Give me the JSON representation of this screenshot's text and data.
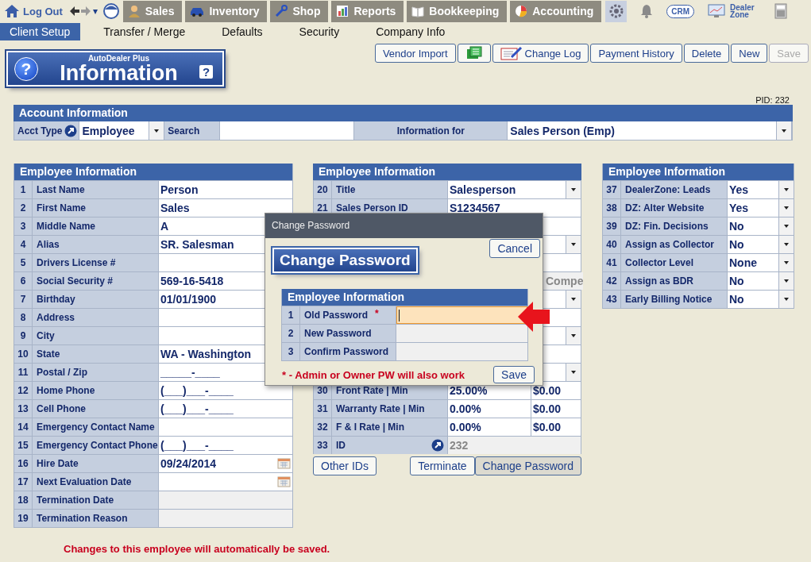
{
  "top_nav": {
    "logout": "Log Out",
    "history_caret": "▾",
    "modules": [
      {
        "label": "Sales",
        "kind": "sales"
      },
      {
        "label": "Inventory",
        "kind": "inventory"
      },
      {
        "label": "Shop",
        "kind": "shop"
      },
      {
        "label": "Reports",
        "kind": "reports"
      },
      {
        "label": "Bookkeeping",
        "kind": "bookkeeping"
      },
      {
        "label": "Accounting",
        "kind": "accounting"
      }
    ],
    "crm": "CRM",
    "dealer_zone": "Dealer Zone"
  },
  "subtabs": [
    {
      "label": "Client Setup",
      "selected": true
    },
    {
      "label": "Transfer / Merge",
      "selected": false
    },
    {
      "label": "Defaults",
      "selected": false
    },
    {
      "label": "Security",
      "selected": false
    },
    {
      "label": "Company Info",
      "selected": false
    }
  ],
  "logo": {
    "brand": "AutoDealer Plus",
    "title": "Information",
    "icon_glyph": "?",
    "help_glyph": "?"
  },
  "toolbar": [
    {
      "label": "Vendor Import",
      "kind": "text",
      "disabled": false
    },
    {
      "kind": "sheet",
      "disabled": false
    },
    {
      "label": "Change Log",
      "kind": "log",
      "disabled": false
    },
    {
      "label": "Payment History",
      "kind": "text",
      "disabled": false
    },
    {
      "label": "Delete",
      "kind": "text",
      "disabled": false
    },
    {
      "label": "New",
      "kind": "text",
      "disabled": false
    },
    {
      "label": "Save",
      "kind": "text",
      "disabled": true
    }
  ],
  "pid": "PID: 232",
  "account": {
    "title": "Account Information",
    "acct_type_label": "Acct Type",
    "acct_type": "Employee",
    "search_label": "Search",
    "info_for_label": "Information for",
    "info_for": "Sales Person (Emp)"
  },
  "left_panel": {
    "title": "Employee Information",
    "rows": [
      {
        "num": "1",
        "label": "Last Name",
        "value": "Person",
        "kind": "text"
      },
      {
        "num": "2",
        "label": "First Name",
        "value": "Sales",
        "kind": "text"
      },
      {
        "num": "3",
        "label": "Middle Name",
        "value": "A",
        "kind": "text"
      },
      {
        "num": "4",
        "label": "Alias",
        "value": "SR. Salesman",
        "kind": "text"
      },
      {
        "num": "5",
        "label": "Drivers License #",
        "kind": "text"
      },
      {
        "num": "6",
        "label": "Social Security #",
        "value": "569-16-5418",
        "kind": "text"
      },
      {
        "num": "7",
        "label": "Birthday",
        "value": "01/01/1900",
        "kind": "text"
      },
      {
        "num": "8",
        "label": "Address",
        "kind": "text"
      },
      {
        "num": "9",
        "label": "City",
        "kind": "text"
      },
      {
        "num": "10",
        "label": "State",
        "value": "WA - Washington",
        "kind": "text"
      },
      {
        "num": "11",
        "label": "Postal / Zip",
        "value": "_____-____",
        "kind": "text"
      },
      {
        "num": "12",
        "label": "Home Phone",
        "value": "(___)___-____",
        "kind": "text"
      },
      {
        "num": "13",
        "label": "Cell Phone",
        "value": "(___)___-____",
        "kind": "text"
      },
      {
        "num": "14",
        "label": "Emergency Contact Name",
        "kind": "text"
      },
      {
        "num": "15",
        "label": "Emergency Contact Phone",
        "value": "(___)___-____",
        "kind": "text"
      },
      {
        "num": "16",
        "label": "Hire Date",
        "value": "09/24/2014",
        "kind": "date"
      },
      {
        "num": "17",
        "label": "Next Evaluation Date",
        "kind": "date"
      },
      {
        "num": "18",
        "label": "Termination Date",
        "kind": "readonly"
      },
      {
        "num": "19",
        "label": "Termination Reason",
        "kind": "readonly"
      }
    ]
  },
  "middle_panel": {
    "title": "Employee Information",
    "rows": [
      {
        "num": "20",
        "label": "Title",
        "value": "Salesperson",
        "kind": "select"
      },
      {
        "num": "21",
        "label": "Sales Person ID",
        "value": "S1234567",
        "kind": "text"
      },
      {
        "kind": "covered"
      },
      {
        "kind": "covered_select"
      },
      {
        "kind": "covered"
      },
      {
        "kind": "covered_readonly",
        "value": "Compe"
      },
      {
        "kind": "covered_select"
      },
      {
        "kind": "covered"
      },
      {
        "kind": "covered_select"
      },
      {
        "kind": "covered"
      },
      {
        "kind": "covered_select"
      },
      {
        "num": "30",
        "label": "Front Rate | Min",
        "value": "25.00%",
        "value2": "$0.00",
        "kind": "split"
      },
      {
        "num": "31",
        "label": "Warranty Rate | Min",
        "value": "0.00%",
        "value2": "$0.00",
        "kind": "split"
      },
      {
        "num": "32",
        "label": "F & I Rate | Min",
        "value": "0.00%",
        "value2": "$0.00",
        "kind": "split"
      },
      {
        "num": "33",
        "label": "ID",
        "value": "232",
        "kind": "id"
      }
    ],
    "buttons": [
      {
        "label": "Other IDs",
        "pressed": false
      },
      {
        "label": "Terminate",
        "pressed": false
      },
      {
        "label": "Change Password",
        "pressed": true
      }
    ]
  },
  "right_panel": {
    "title": "Employee Information",
    "rows": [
      {
        "num": "37",
        "label": "DealerZone:  Leads",
        "value": "Yes"
      },
      {
        "num": "38",
        "label": "DZ: Alter Website",
        "value": "Yes"
      },
      {
        "num": "39",
        "label": "DZ:  Fin. Decisions",
        "value": "No"
      },
      {
        "num": "40",
        "label": "Assign as Collector",
        "value": "No"
      },
      {
        "num": "41",
        "label": "Collector Level",
        "value": "None"
      },
      {
        "num": "42",
        "label": "Assign as BDR",
        "value": "No"
      },
      {
        "num": "43",
        "label": "Early Billing Notice",
        "value": "No"
      }
    ]
  },
  "footer_note": "Changes to this employee will automatically be saved.",
  "dialog": {
    "window_title": "Change Password",
    "heading": "Change Password",
    "cancel": "Cancel",
    "table_title": "Employee Information",
    "rows": [
      {
        "num": "1",
        "label": "Old Password",
        "mark": "*",
        "focused": true
      },
      {
        "num": "2",
        "label": "New Password",
        "focused": false
      },
      {
        "num": "3",
        "label": "Confirm Password",
        "focused": false
      }
    ],
    "note": "* - Admin or Owner PW will also work",
    "save": "Save"
  }
}
